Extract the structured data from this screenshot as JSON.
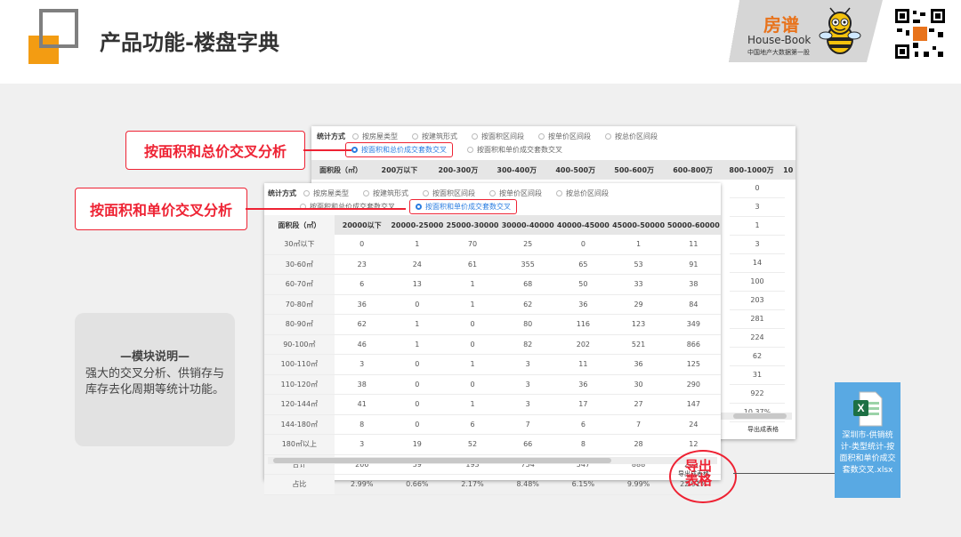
{
  "header": {
    "title": "产品功能-楼盘字典",
    "logo_cn": "房谱",
    "logo_en": "House-Book",
    "logo_sub": "中国地产大数据第一股"
  },
  "callouts": {
    "area_total_price": "按面积和总价交叉分析",
    "area_unit_price": "按面积和单价交叉分析",
    "export_line1": "导出",
    "export_line2": "表格"
  },
  "module_note": {
    "heading": "—模块说明—",
    "body": "强大的交叉分析、供销存与库存去化周期等统计功能。"
  },
  "excel_file": {
    "name": "深圳市-供销统计-类型统计-按面积和单价成交套数交叉.xlsx"
  },
  "panel_back": {
    "stats_label": "统计方式",
    "options_row1": [
      "按房屋类型",
      "按建筑形式",
      "按面积区间段",
      "按单价区间段",
      "按总价区间段"
    ],
    "options_row2": [
      "按面积和总价成交套数交叉",
      "按面积和单价成交套数交叉"
    ],
    "selected": "按面积和总价成交套数交叉",
    "headers": [
      "面积段（㎡）",
      "200万以下",
      "200-300万",
      "300-400万",
      "400-500万",
      "500-600万",
      "600-800万",
      "800-1000万",
      "10"
    ],
    "last_col_values": [
      "0",
      "3",
      "1",
      "3",
      "14",
      "100",
      "203",
      "281",
      "224",
      "62",
      "31",
      "922",
      "10.37%"
    ],
    "export_label": "导出成表格"
  },
  "panel_front": {
    "stats_label": "统计方式",
    "options_row1": [
      "按房屋类型",
      "按建筑形式",
      "按面积区间段",
      "按单价区间段",
      "按总价区间段"
    ],
    "options_row2": [
      "按面积和总价成交套数交叉",
      "按面积和单价成交套数交叉"
    ],
    "selected": "按面积和单价成交套数交叉",
    "headers": [
      "面积段（㎡）",
      "20000以下",
      "20000-25000",
      "25000-30000",
      "30000-40000",
      "40000-45000",
      "45000-50000",
      "50000-60000"
    ],
    "rows": [
      [
        "30㎡以下",
        "0",
        "1",
        "70",
        "25",
        "0",
        "1",
        "11"
      ],
      [
        "30-60㎡",
        "23",
        "24",
        "61",
        "355",
        "65",
        "53",
        "91"
      ],
      [
        "60-70㎡",
        "6",
        "13",
        "1",
        "68",
        "50",
        "33",
        "38"
      ],
      [
        "70-80㎡",
        "36",
        "0",
        "1",
        "62",
        "36",
        "29",
        "84"
      ],
      [
        "80-90㎡",
        "62",
        "1",
        "0",
        "80",
        "116",
        "123",
        "349"
      ],
      [
        "90-100㎡",
        "46",
        "1",
        "0",
        "82",
        "202",
        "521",
        "866"
      ],
      [
        "100-110㎡",
        "3",
        "0",
        "1",
        "3",
        "11",
        "36",
        "125"
      ],
      [
        "110-120㎡",
        "38",
        "0",
        "0",
        "3",
        "36",
        "30",
        "290"
      ],
      [
        "120-144㎡",
        "41",
        "0",
        "1",
        "3",
        "17",
        "27",
        "147"
      ],
      [
        "144-180㎡",
        "8",
        "0",
        "6",
        "7",
        "6",
        "7",
        "24"
      ],
      [
        "180㎡以上",
        "3",
        "19",
        "52",
        "66",
        "8",
        "28",
        "12"
      ],
      [
        "合计",
        "266",
        "59",
        "193",
        "754",
        "547",
        "888",
        "2037"
      ],
      [
        "占比",
        "2.99%",
        "0.66%",
        "2.17%",
        "8.48%",
        "6.15%",
        "9.99%",
        "22.91%"
      ]
    ],
    "export_label": "导出成表格"
  },
  "colors": {
    "accent_orange": "#f39c12",
    "callout_red": "#e22233",
    "selected_blue": "#2a7de1",
    "excel_tile": "#59a9e3",
    "excel_green": "#1d7044"
  }
}
